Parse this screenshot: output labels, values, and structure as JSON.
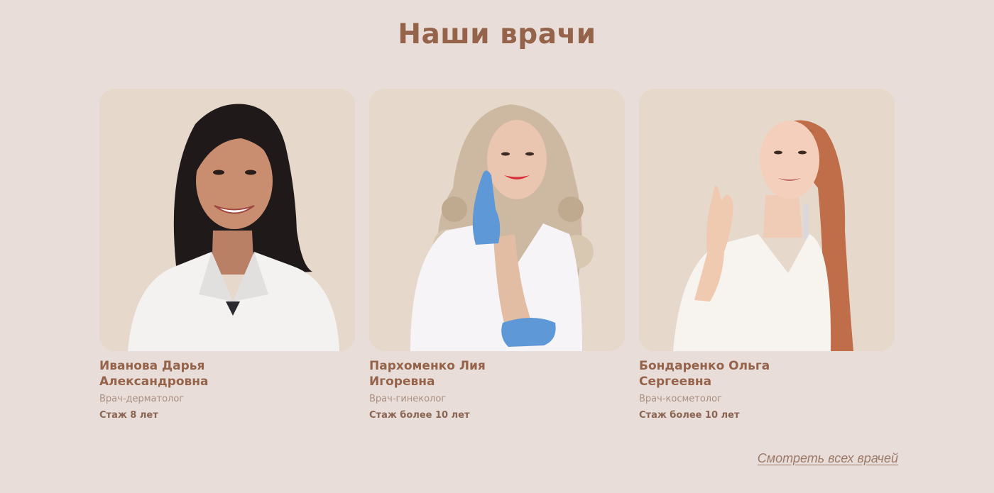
{
  "section": {
    "title": "Наши врачи"
  },
  "doctors": [
    {
      "name_line1": "Иванова Дарья",
      "name_line2": "Александровна",
      "specialty": "Врач-дерматолог",
      "experience": "Стаж 8 лет"
    },
    {
      "name_line1": "Пархоменко Лия",
      "name_line2": "Игоревна",
      "specialty": "Врач-гинеколог",
      "experience": "Стаж более 10 лет"
    },
    {
      "name_line1": "Бондаренко Ольга",
      "name_line2": "Сергеевна",
      "specialty": "Врач-косметолог",
      "experience": "Стаж более 10 лет"
    }
  ],
  "footer": {
    "view_all_link": "Смотреть всех врачей"
  },
  "colors": {
    "background": "#e8ddd8",
    "card_background": "#e6d8cb",
    "accent": "#95634a",
    "muted_text": "#a98f82",
    "link": "#9b7969"
  }
}
